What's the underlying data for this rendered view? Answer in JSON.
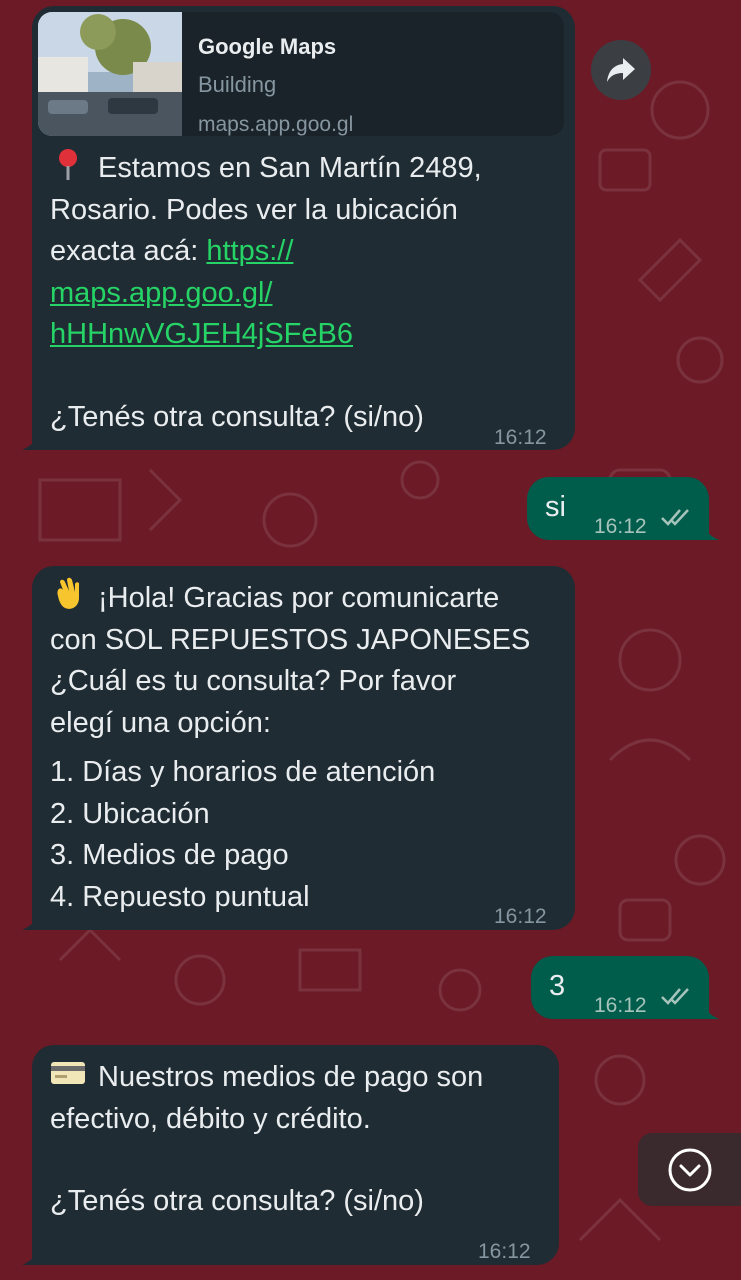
{
  "messages": {
    "m1": {
      "preview": {
        "title": "Google Maps",
        "description": "Building",
        "url": "maps.app.goo.gl"
      },
      "line1": "Estamos en San Martín 2489,",
      "line2": "Rosario. Podes ver la ubicación",
      "line3_prefix": "exacta acá: ",
      "link_line1": "https://",
      "link_line2": "maps.app.goo.gl/",
      "link_line3": "hHHnwVGJEH4jSFeB6",
      "question": "¿Tenés otra consulta? (si/no)",
      "time": "16:12",
      "emoji": "round-pushpin-icon"
    },
    "m2": {
      "text": "si",
      "time": "16:12",
      "status": "read"
    },
    "m3": {
      "line1": "¡Hola! Gracias por comunicarte",
      "line2": "con SOL REPUESTOS JAPONESES",
      "line3": "¿Cuál es tu consulta? Por favor",
      "line4": "elegí una opción:",
      "options": [
        "1. Días y horarios de atención",
        "2. Ubicación",
        "3. Medios de pago",
        "4. Repuesto puntual"
      ],
      "time": "16:12",
      "emoji": "waving-hand-icon"
    },
    "m4": {
      "text": "3",
      "time": "16:12",
      "status": "read"
    },
    "m5": {
      "line1": "Nuestros medios de pago son",
      "line2": "efectivo, débito y crédito.",
      "question": "¿Tenés otra consulta? (si/no)",
      "time": "16:12",
      "emoji": "credit-card-icon"
    }
  },
  "colors": {
    "background": "#6b1a26",
    "incoming_bubble": "#202c33",
    "outgoing_bubble": "#005c4b",
    "link": "#25d366"
  }
}
